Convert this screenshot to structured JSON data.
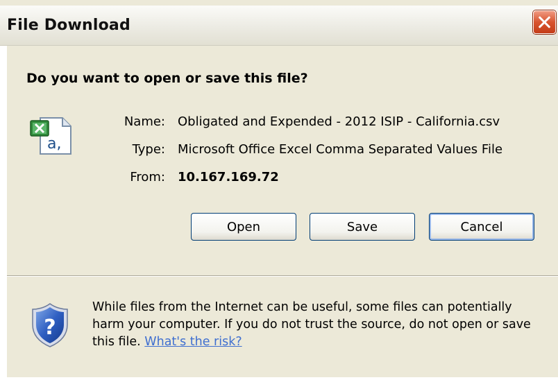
{
  "window": {
    "title": "File Download"
  },
  "dialog": {
    "question": "Do you want to open or save this file?",
    "file": {
      "icon": "excel-csv-file-icon",
      "name_label": "Name:",
      "name_value": "Obligated and Expended - 2012 ISIP - California.csv",
      "type_label": "Type:",
      "type_value": "Microsoft Office Excel Comma Separated Values File",
      "from_label": "From:",
      "from_value": "10.167.169.72"
    },
    "buttons": {
      "open": "Open",
      "save": "Save",
      "cancel": "Cancel"
    },
    "warning": {
      "icon": "security-shield-question-icon",
      "text": "While files from the Internet can be useful, some files can potentially harm your computer. If you do not trust the source, do not open or save this file.",
      "link": "What's the risk?"
    }
  },
  "colors": {
    "dialog_bg": "#ece9d8",
    "close_button": "#d8542f",
    "link": "#3f6fd0",
    "button_border": "#003c74"
  }
}
